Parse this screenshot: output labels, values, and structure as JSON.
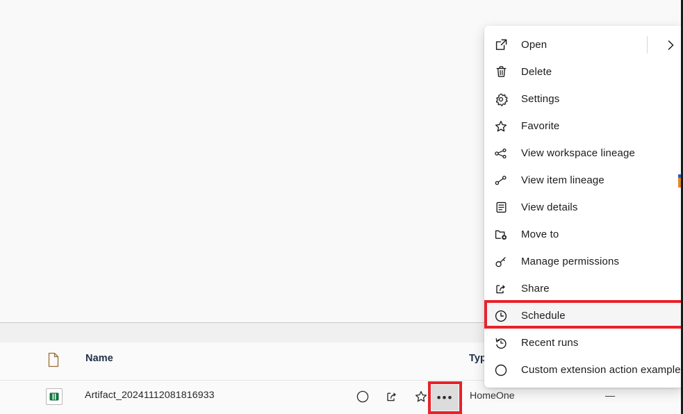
{
  "context_menu": {
    "items": [
      {
        "label": "Open",
        "icon": "open-external-icon",
        "has_submenu": true,
        "highlighted": false
      },
      {
        "label": "Delete",
        "icon": "trash-icon",
        "has_submenu": false,
        "highlighted": false
      },
      {
        "label": "Settings",
        "icon": "gear-icon",
        "has_submenu": false,
        "highlighted": false
      },
      {
        "label": "Favorite",
        "icon": "star-icon",
        "has_submenu": false,
        "highlighted": false
      },
      {
        "label": "View workspace lineage",
        "icon": "workspace-lineage-icon",
        "has_submenu": false,
        "highlighted": false
      },
      {
        "label": "View item lineage",
        "icon": "item-lineage-icon",
        "has_submenu": false,
        "highlighted": false
      },
      {
        "label": "View details",
        "icon": "details-icon",
        "has_submenu": false,
        "highlighted": false
      },
      {
        "label": "Move to",
        "icon": "folder-move-icon",
        "has_submenu": false,
        "highlighted": false
      },
      {
        "label": "Manage permissions",
        "icon": "key-icon",
        "has_submenu": false,
        "highlighted": false
      },
      {
        "label": "Share",
        "icon": "share-icon",
        "has_submenu": false,
        "highlighted": false
      },
      {
        "label": "Schedule",
        "icon": "clock-icon",
        "has_submenu": false,
        "highlighted": true
      },
      {
        "label": "Recent runs",
        "icon": "history-icon",
        "has_submenu": false,
        "highlighted": false
      },
      {
        "label": "Custom extension action example",
        "icon": "circle-icon",
        "has_submenu": false,
        "highlighted": false
      }
    ]
  },
  "table": {
    "headers": {
      "icon": "file-type-icon",
      "name": "Name",
      "type": "Typ"
    },
    "rows": [
      {
        "item_icon": "report-icon",
        "name": "Artifact_20241112081816933",
        "type": "HomeOne",
        "owner": "—",
        "actions": [
          {
            "name": "endorsement-icon",
            "glyph": "circle"
          },
          {
            "name": "share-icon",
            "glyph": "share"
          },
          {
            "name": "favorite-icon",
            "glyph": "star"
          },
          {
            "name": "more-options-icon",
            "glyph": "ellipsis"
          }
        ]
      }
    ]
  },
  "annotations": {
    "highlight_color": "#e8222a",
    "highlighted_menu_item": "Schedule",
    "highlighted_button": "more-options-icon"
  }
}
